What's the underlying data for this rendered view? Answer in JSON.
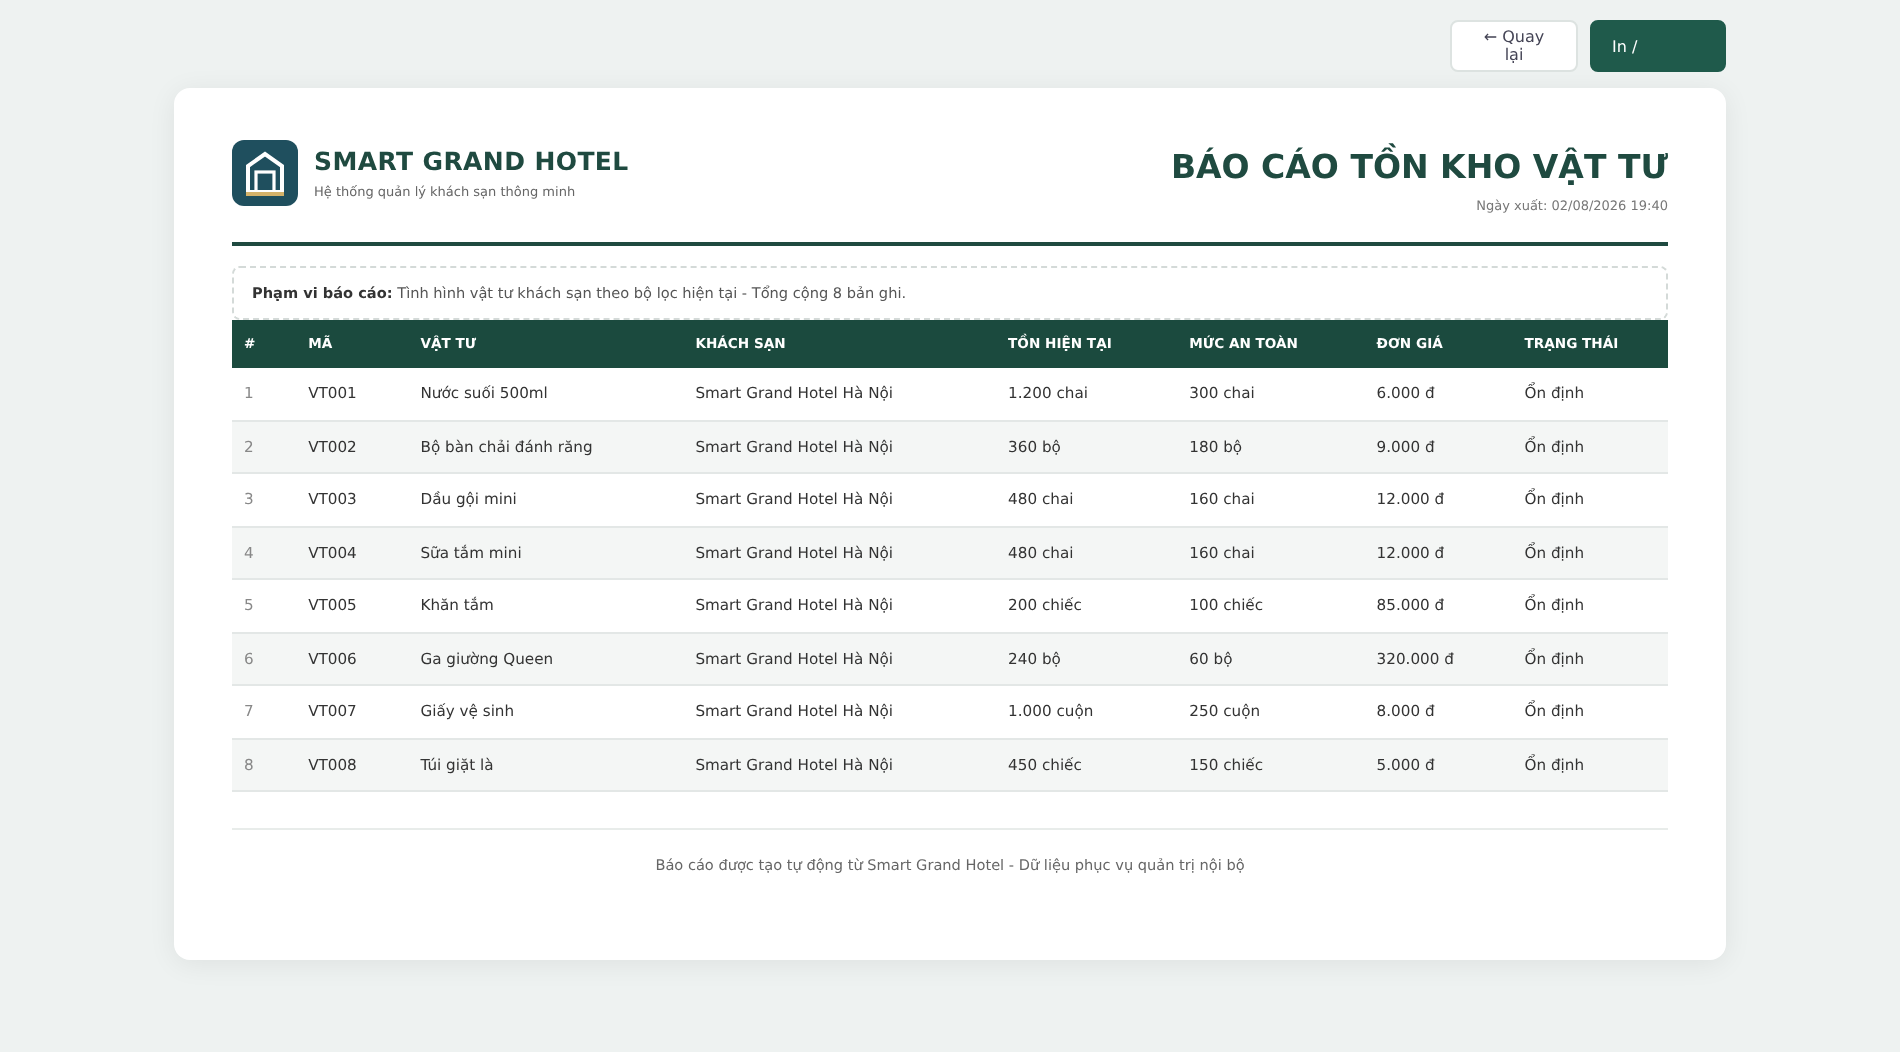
{
  "toolbar": {
    "buttons": [
      {
        "label": "← Quay lại",
        "kind": "secondary"
      },
      {
        "label": "In /",
        "kind": "primary"
      }
    ]
  },
  "header": {
    "brand": "SMART GRAND HOTEL",
    "tagline": "Hệ thống quản lý khách sạn thông minh",
    "title": "BÁO CÁO TỒN KHO VẬT TƯ",
    "export_date": "Ngày xuất: 02/08/2026 19:40"
  },
  "scope": "**Phạm vi báo cáo:** Tình hình vật tư khách sạn theo bộ lọc hiện tại - Tổng cộng 8 bản ghi.",
  "table": {
    "columns": [
      "#",
      "MÃ",
      "VẬT TƯ",
      "KHÁCH SẠN",
      "TỒN HIỆN TẠI",
      "MỨC AN TOÀN",
      "ĐƠN GIÁ",
      "TRẠNG THÁI"
    ],
    "rows": [
      [
        "1",
        "VT001",
        "Nước suối 500ml",
        "Smart Grand Hotel Hà Nội",
        "1.200 chai",
        "300 chai",
        "6.000 đ",
        "Ổn định"
      ],
      [
        "2",
        "VT002",
        "Bộ bàn chải đánh răng",
        "Smart Grand Hotel Hà Nội",
        "360 bộ",
        "180 bộ",
        "9.000 đ",
        "Ổn định"
      ],
      [
        "3",
        "VT003",
        "Dầu gội mini",
        "Smart Grand Hotel Hà Nội",
        "480 chai",
        "160 chai",
        "12.000 đ",
        "Ổn định"
      ],
      [
        "4",
        "VT004",
        "Sữa tắm mini",
        "Smart Grand Hotel Hà Nội",
        "480 chai",
        "160 chai",
        "12.000 đ",
        "Ổn định"
      ],
      [
        "5",
        "VT005",
        "Khăn tắm",
        "Smart Grand Hotel Hà Nội",
        "200 chiếc",
        "100 chiếc",
        "85.000 đ",
        "Ổn định"
      ],
      [
        "6",
        "VT006",
        "Ga giường Queen",
        "Smart Grand Hotel Hà Nội",
        "240 bộ",
        "60 bộ",
        "320.000 đ",
        "Ổn định"
      ],
      [
        "7",
        "VT007",
        "Giấy vệ sinh",
        "Smart Grand Hotel Hà Nội",
        "1.000 cuộn",
        "250 cuộn",
        "8.000 đ",
        "Ổn định"
      ],
      [
        "8",
        "VT008",
        "Túi giặt là",
        "Smart Grand Hotel Hà Nội",
        "450 chiếc",
        "150 chiếc",
        "5.000 đ",
        "Ổn định"
      ]
    ]
  },
  "footer": "Báo cáo được tạo tự động từ Smart Grand Hotel - Dữ liệu phục vụ quản trị nội bộ"
}
